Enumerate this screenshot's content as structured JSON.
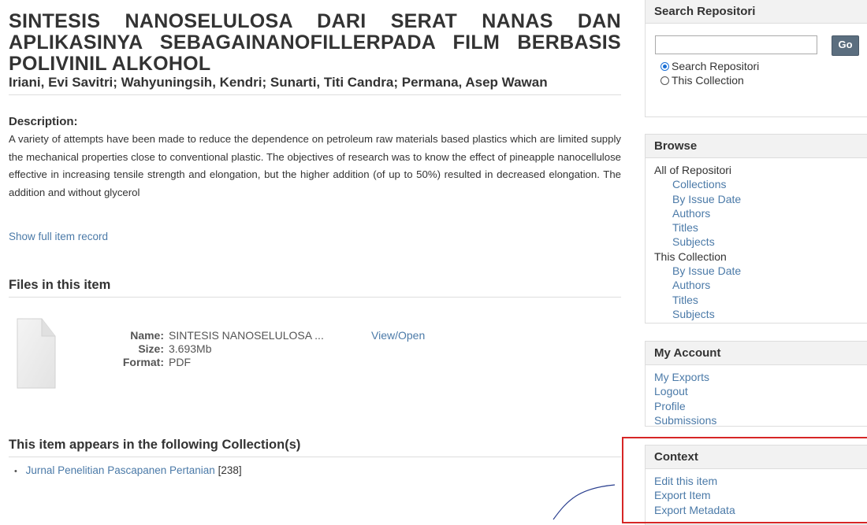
{
  "item": {
    "title": "SINTESIS NANOSELULOSA DARI SERAT NANAS DAN APLIKASINYA SEBAGAINANOFILLERPADA FILM BERBASIS POLIVINIL ALKOHOL",
    "authors": "Iriani, Evi Savitri; Wahyuningsih, Kendri; Sunarti, Titi Candra; Permana, Asep Wawan",
    "description_label": "Description:",
    "description": "A variety of attempts have been made to reduce the dependence on petroleum raw materials based plastics which are limited supply the mechanical properties close to conventional plastic. The objectives of research was to know the effect of  pineapple nanocellulose effective in increasing tensile strength and elongation, but the higher addition (of up to 50%) resulted in decreased elongation. The addition and without glycerol",
    "show_full_record": "Show full item record"
  },
  "files": {
    "heading": "Files in this item",
    "name_label": "Name:",
    "name_value": "SINTESIS NANOSELULOSA ...",
    "size_label": "Size:",
    "size_value": "3.693Mb",
    "format_label": "Format:",
    "format_value": "PDF",
    "view_open": "View/Open",
    "icon": "file-icon"
  },
  "collections": {
    "heading": "This item appears in the following Collection(s)",
    "items": [
      {
        "name": "Jurnal Penelitian Pascapanen Pertanian",
        "count": "[238]"
      }
    ]
  },
  "sidebar": {
    "search": {
      "heading": "Search Repositori",
      "input_value": "",
      "go_label": "Go",
      "radio_repo": "Search Repositori",
      "radio_collection": "This Collection"
    },
    "browse": {
      "heading": "Browse",
      "all_label": "All of Repositori",
      "all_items": [
        "Collections",
        "By Issue Date",
        "Authors",
        "Titles",
        "Subjects"
      ],
      "collection_label": "This Collection",
      "collection_items": [
        "By Issue Date",
        "Authors",
        "Titles",
        "Subjects"
      ]
    },
    "account": {
      "heading": "My Account",
      "items": [
        "My Exports",
        "Logout",
        "Profile",
        "Submissions"
      ]
    },
    "context": {
      "heading": "Context",
      "items": [
        "Edit this item",
        "Export Item",
        "Export Metadata"
      ]
    }
  },
  "colors": {
    "link": "#4b7aa8",
    "highlight": "#d62626",
    "annotation": "#2a3f8f",
    "go_button": "#5b6e7f"
  }
}
